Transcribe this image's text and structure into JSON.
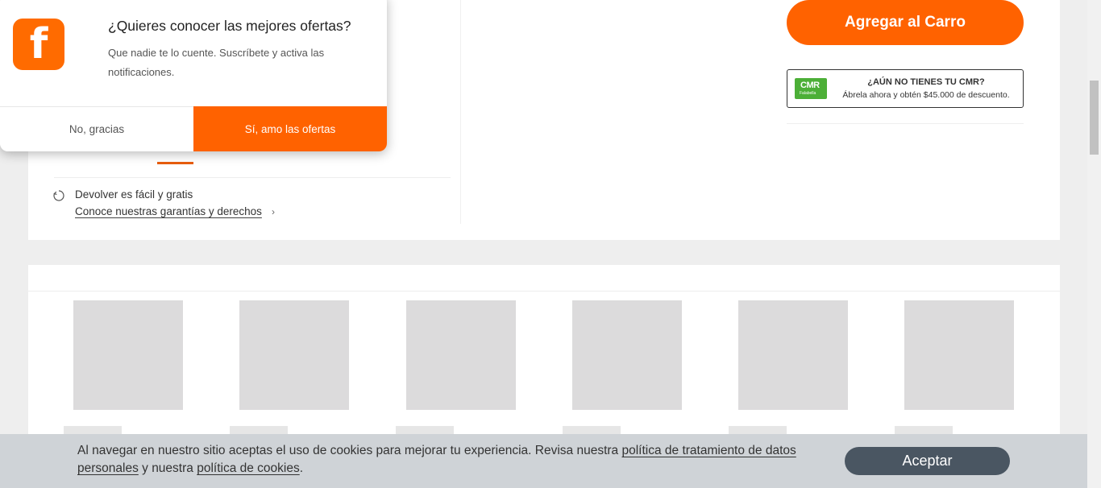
{
  "notification": {
    "logo_letter": "f",
    "title": "¿Quieres conocer las mejores ofertas?",
    "body": "Que nadie te lo cuente. Suscríbete y activa las notificaciones.",
    "decline_label": "No, gracias",
    "accept_label": "Sí, amo las ofertas"
  },
  "product": {
    "add_to_cart_label": "Agregar al Carro",
    "cmr": {
      "logo_text": "CMR",
      "logo_subtext": "Falabella",
      "title": "¿AÚN NO TIENES TU CMR?",
      "subtitle": "Ábrela ahora y obtén $45.000 de descuento."
    },
    "returns": {
      "title": "Devolver es fácil y gratis",
      "link": "Conoce nuestras garantías y derechos",
      "chevron": "›"
    }
  },
  "cookie_banner": {
    "text_before": "Al navegar en nuestro sitio aceptas el uso de cookies para mejorar tu experiencia. Revisa nuestra ",
    "link1": "política de tratamiento de datos personales",
    "text_middle": " y nuestra ",
    "link2": "política de cookies",
    "text_after": ".",
    "accept_label": "Aceptar"
  },
  "colors": {
    "brand_orange": "#ff6200",
    "cmr_green": "#4caf37",
    "cookie_button": "#4a5662"
  }
}
